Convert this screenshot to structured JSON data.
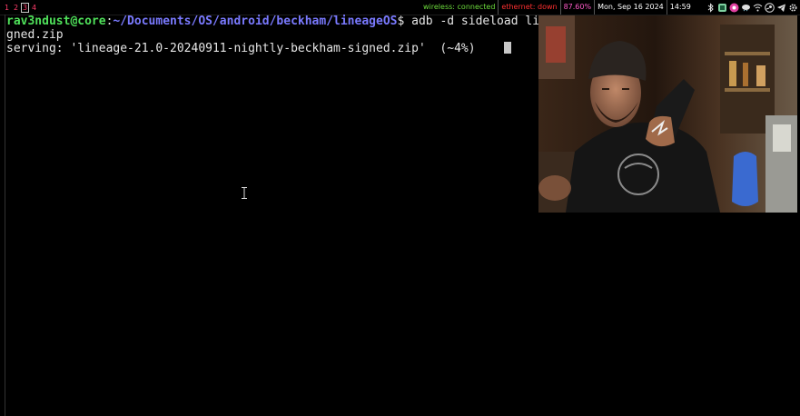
{
  "workspaces": [
    "1",
    "2",
    "3",
    "4"
  ],
  "active_workspace": "3",
  "status": {
    "wireless": "wireless: connected",
    "ethernet": "ethernet: down",
    "battery": "87.60%",
    "date": "Mon, Sep 16 2024",
    "time": "14:59"
  },
  "tray_icons": [
    "bluetooth-icon",
    "app-icon",
    "app-icon",
    "weather-icon",
    "network-icon",
    "steam-icon",
    "telegram-icon",
    "settings-icon"
  ],
  "terminal": {
    "prompt_user": "rav3ndust@core",
    "prompt_sep": ":",
    "prompt_path": "~/Documents/OS/android/beckham/lineageOS",
    "prompt_symbol": "$",
    "command": " adb -d sideload line",
    "wrap_line": "gned.zip",
    "output_line": "serving: 'lineage-21.0-20240911-nightly-beckham-signed.zip'  (~4%)"
  },
  "colors": {
    "workspace": "#ff3c6a",
    "wireless": "#6ddc3c",
    "ethernet": "#ff3030",
    "battery": "#ff5ac8",
    "clock": "#ffffff",
    "prompt_user": "#4fe05a",
    "prompt_path": "#7a7aff"
  }
}
